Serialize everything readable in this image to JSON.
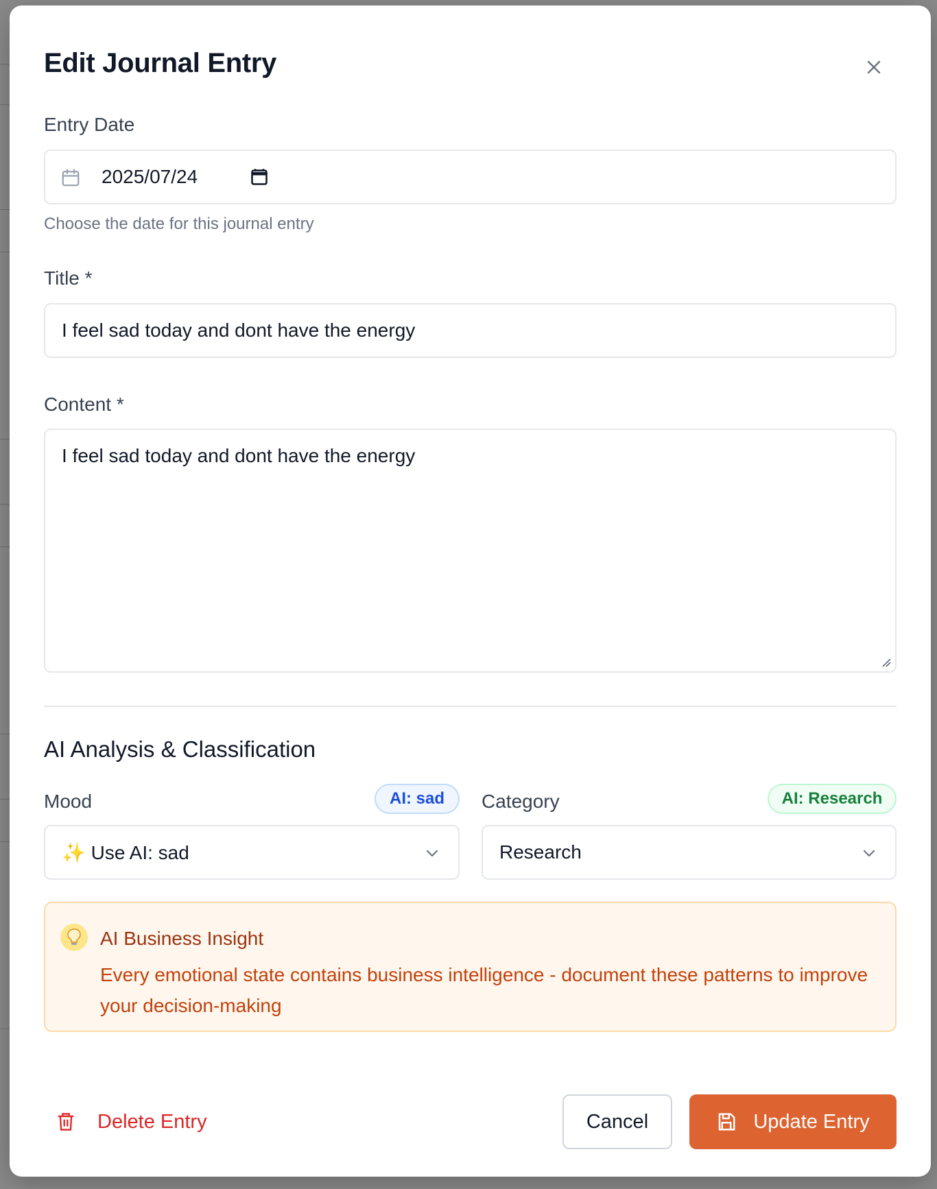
{
  "colors": {
    "accent": "#dd6330",
    "danger": "#dc2626",
    "ai_mood_pill": "#1d4ed8",
    "ai_category_pill": "#15803d",
    "insight_bg": "#fff7ed"
  },
  "modal": {
    "title": "Edit Journal Entry",
    "close_icon": "close-icon"
  },
  "entry_date": {
    "label": "Entry Date",
    "value": "2025/07/24",
    "hint": "Choose the date for this journal entry",
    "icon": "calendar-icon"
  },
  "title_field": {
    "label": "Title *",
    "value": "I feel sad today and dont have the energy"
  },
  "content_field": {
    "label": "Content *",
    "value": "I feel sad today and dont have the energy"
  },
  "ai_section": {
    "title": "AI Analysis & Classification",
    "mood": {
      "label": "Mood",
      "ai_pill": "AI: sad",
      "selected": "✨ Use AI: sad"
    },
    "category": {
      "label": "Category",
      "ai_pill": "AI: Research",
      "selected": "Research"
    }
  },
  "insight": {
    "title": "AI Business Insight",
    "text": "Every emotional state contains business intelligence - document these patterns to improve your decision-making",
    "icon": "lightbulb-icon"
  },
  "footer": {
    "delete_label": "Delete Entry",
    "cancel_label": "Cancel",
    "update_label": "Update Entry"
  }
}
